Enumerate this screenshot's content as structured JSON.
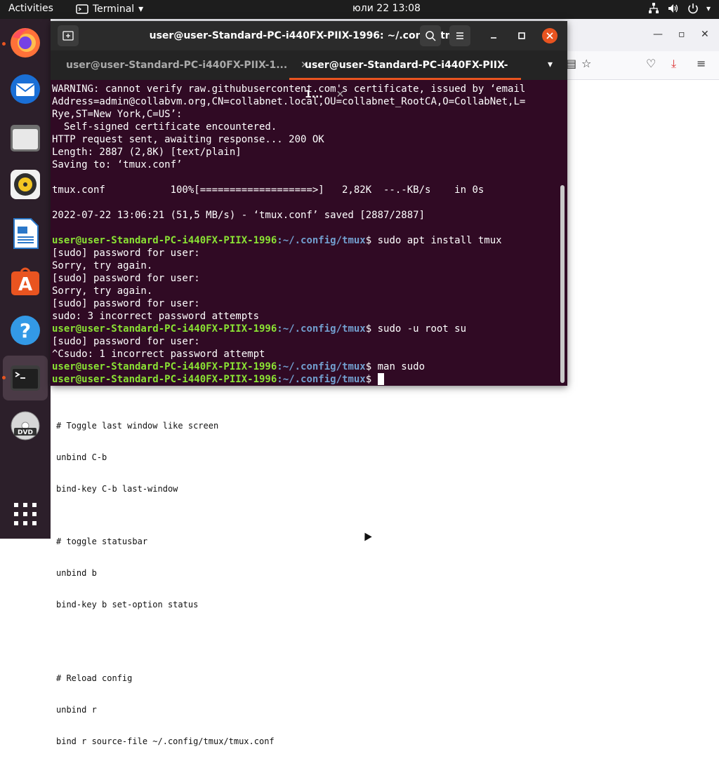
{
  "topbar": {
    "activities": "Activities",
    "app_name": "Terminal",
    "clock": "юли 22  13:08"
  },
  "dock": {
    "items": [
      "firefox-icon",
      "thunderbird-icon",
      "files-icon",
      "rhythmbox-icon",
      "libreoffice-writer-icon",
      "software-icon",
      "help-icon",
      "terminal-icon",
      "dvd-icon",
      "show-apps-icon"
    ]
  },
  "terminal": {
    "title": "user@user-Standard-PC-i440FX-PIIX-1996: ~/.config/tmux",
    "tabs": [
      {
        "label": "user@user-Standard-PC-i440FX-PIIX-1...",
        "active": false
      },
      {
        "label": "user@user-Standard-PC-i440FX-PIIX-1...",
        "active": true
      }
    ],
    "prompt_user": "user@user-Standard-PC-i440FX-PIIX-1996",
    "prompt_path": ":~/.config/tmux",
    "lines": [
      "WARNING: cannot verify raw.githubusercontent.com's certificate, issued by ‘email",
      "Address=admin@collabvm.org,CN=collabnet.local,OU=collabnet_RootCA,O=CollabNet,L=",
      "Rye,ST=New York,C=US’:",
      "  Self-signed certificate encountered.",
      "HTTP request sent, awaiting response... 200 OK",
      "Length: 2887 (2,8K) [text/plain]",
      "Saving to: ‘tmux.conf’",
      "",
      "tmux.conf           100%[===================>]   2,82K  --.-KB/s    in 0s",
      "",
      "2022-07-22 13:06:21 (51,5 MB/s) - ‘tmux.conf’ saved [2887/2887]",
      ""
    ],
    "cmd1": "$ sudo apt install tmux",
    "lines2": [
      "[sudo] password for user:",
      "Sorry, try again.",
      "[sudo] password for user:",
      "Sorry, try again.",
      "[sudo] password for user:",
      "sudo: 3 incorrect password attempts"
    ],
    "cmd2": "$ sudo -u root su",
    "lines3": [
      "[sudo] password for user:",
      "^Csudo: 1 incorrect password attempt"
    ],
    "cmd3": "$ man sudo",
    "cmd4": "$ "
  },
  "browser": {
    "doc_lines": [
      "# Toggle last window like screen",
      "unbind C-b",
      "bind-key C-b last-window",
      "",
      "# toggle statusbar",
      "unbind b",
      "bind-key b set-option status",
      "",
      "",
      "# Reload config",
      "unbind r",
      "bind r source-file ~/.config/tmux/tmux.conf"
    ]
  }
}
